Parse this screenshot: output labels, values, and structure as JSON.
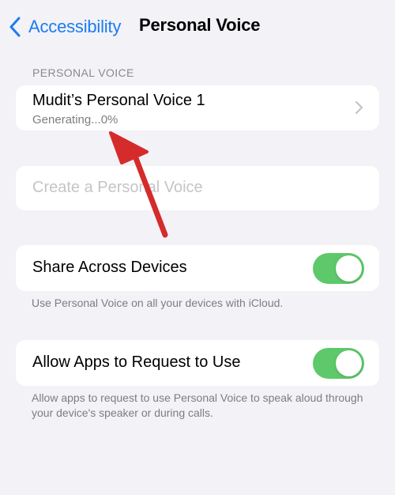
{
  "nav": {
    "back_label": "Accessibility",
    "title": "Personal Voice"
  },
  "section": {
    "header": "PERSONAL VOICE"
  },
  "voice": {
    "name": "Mudit’s Personal Voice 1",
    "status": "Generating...0%",
    "progress_percent": 0
  },
  "create": {
    "label": "Create a Personal Voice"
  },
  "share": {
    "label": "Share Across Devices",
    "on": true,
    "footer": "Use Personal Voice on all your devices with iCloud."
  },
  "allow": {
    "label": "Allow Apps to Request to Use",
    "on": true,
    "footer": "Allow apps to request to use Personal Voice to speak aloud through your device's speaker or during calls."
  },
  "colors": {
    "accent": "#1c7cf0",
    "toggle_on": "#5dc96a",
    "annotation_arrow": "#d52b2b"
  },
  "icons": {
    "back": "chevron-left-icon",
    "disclosure": "chevron-right-icon",
    "annotation": "red-arrow"
  }
}
